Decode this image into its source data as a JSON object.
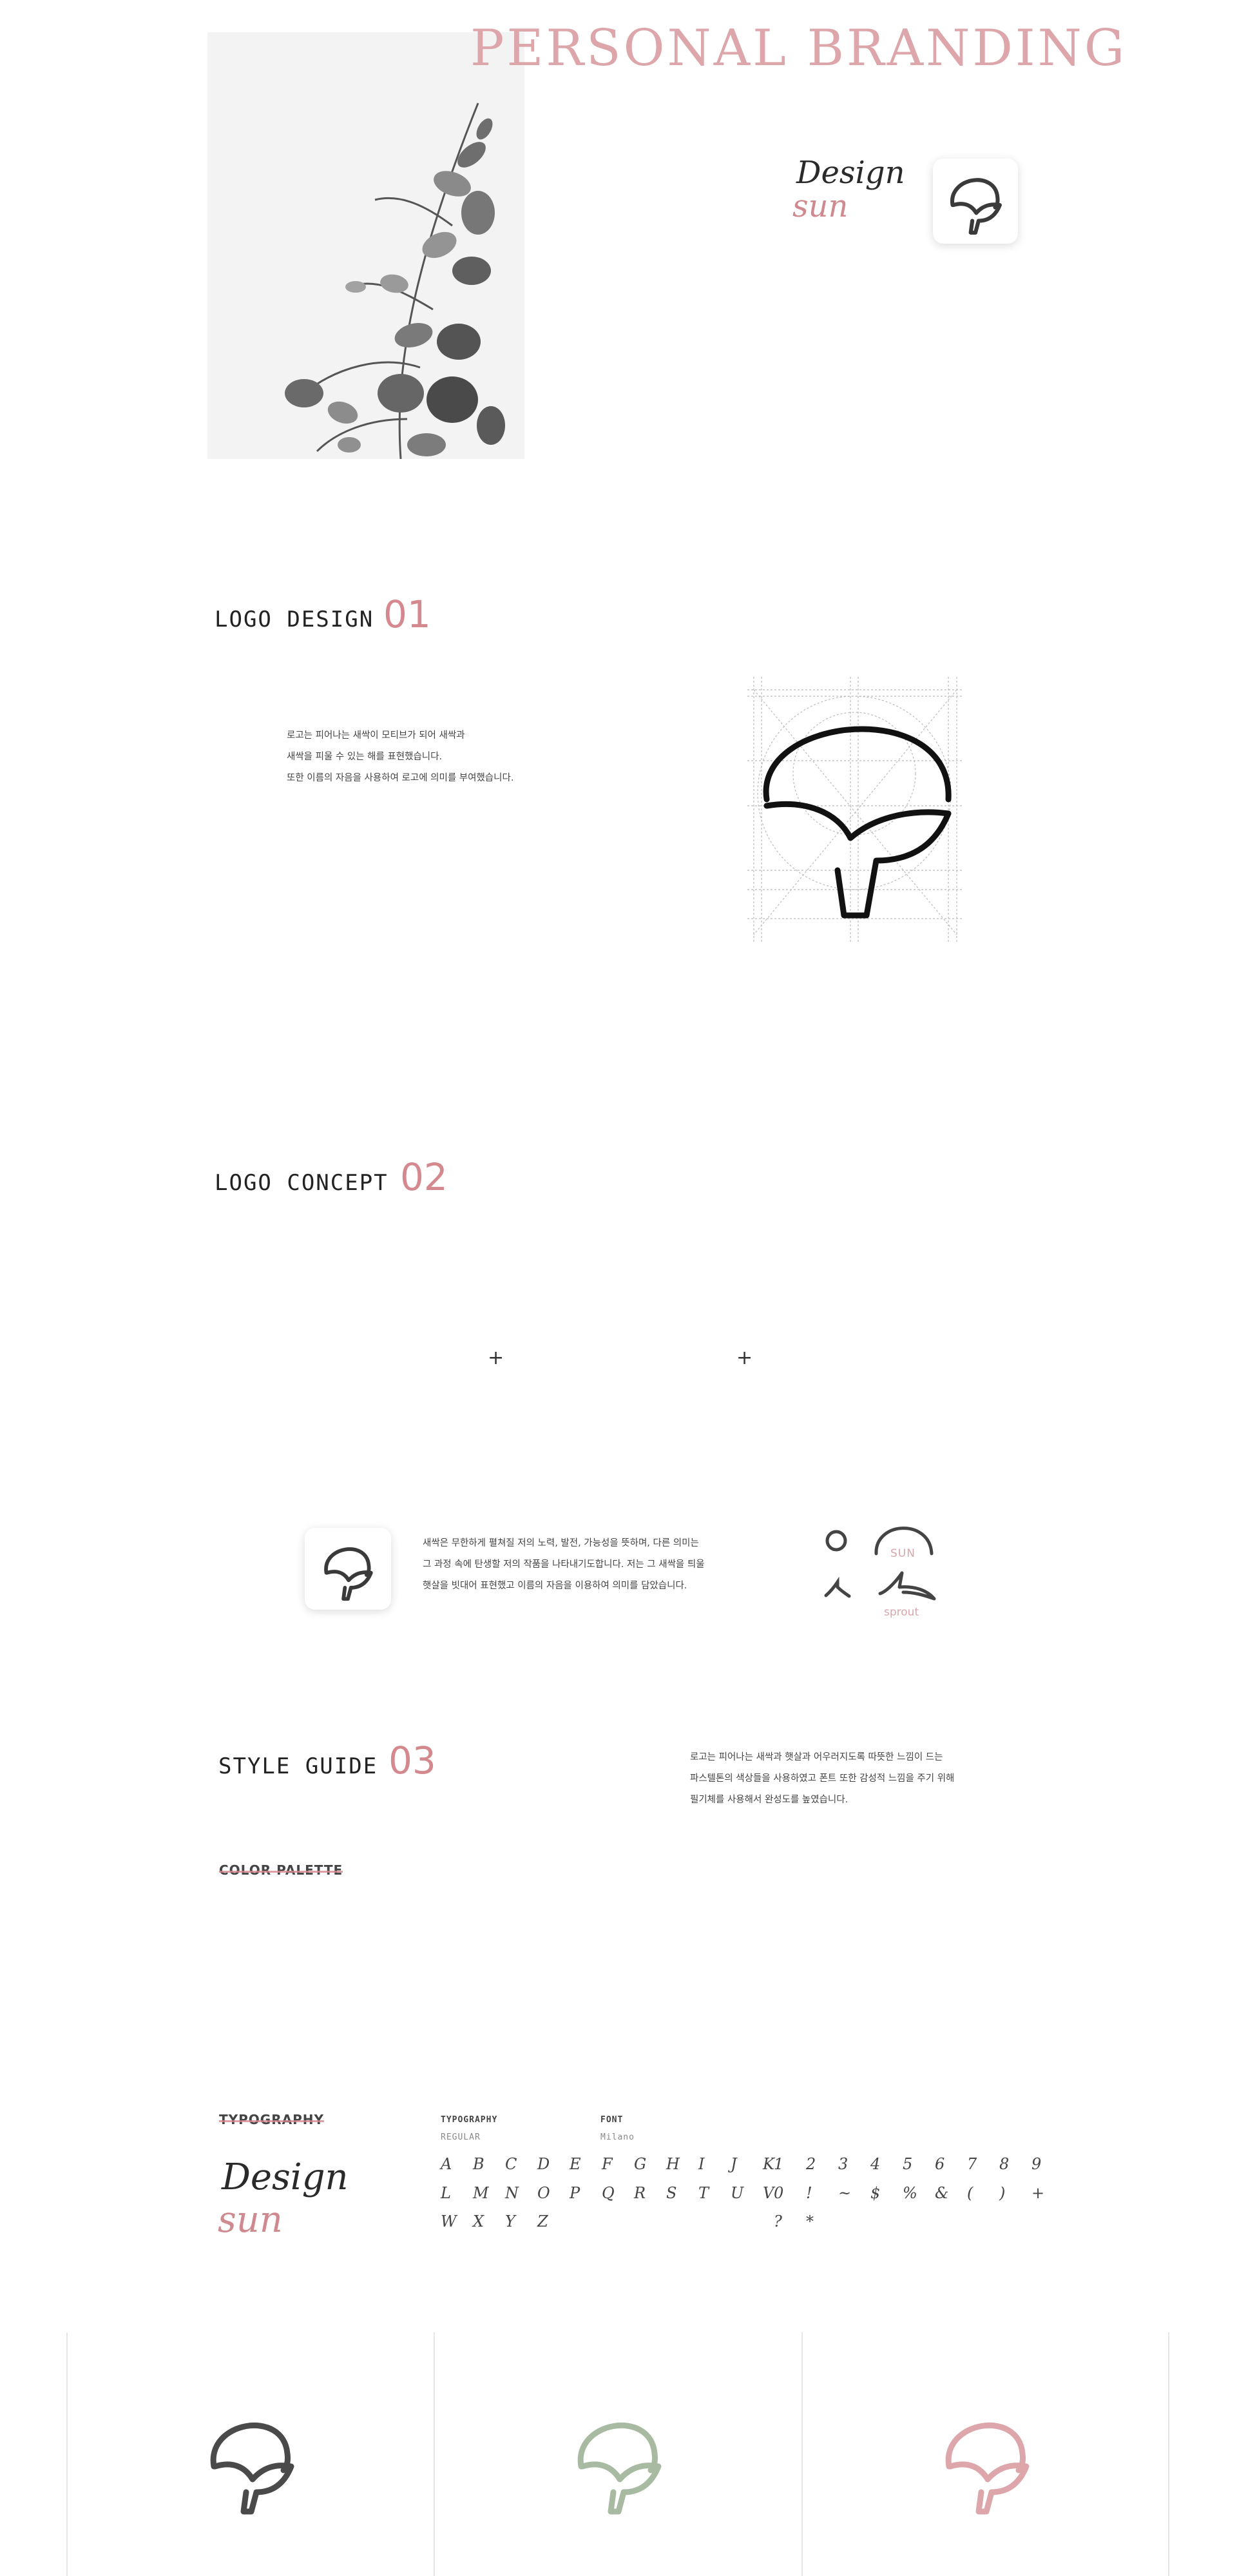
{
  "hero": {
    "title": "PERSONAL BRANDING",
    "script_line1": "Design",
    "script_line2": "sun",
    "photo_icon": "eucalyptus-branch-photo"
  },
  "logo_design": {
    "title": "LOGO DESIGN",
    "number": "01",
    "paragraph": [
      "로고는 피어나는 새싹이 모티브가 되어 새싹과",
      "새싹을 피울 수 있는 해를 표현했습니다.",
      "또한 이름의 자음을 사용하여 로고에 의미를 부여했습니다."
    ]
  },
  "logo_concept": {
    "title": "LOGO CONCEPT",
    "number": "02",
    "plus_1": "+",
    "plus_2": "+",
    "paragraph": [
      "새싹은 무한하게 펼쳐질 저의 노력, 발전, 가능성을 뜻하며, 다른 의미는",
      "그 과정 속에 탄생할 저의 작품을 나타내기도합니다. 저는 그 새싹을 틔울",
      "햇살을 빗대어 표현했고 이름의 자음을 이용하여 의미를 담았습니다."
    ],
    "sun_label": "SUN",
    "sprout_label": "sprout"
  },
  "style_guide": {
    "title": "STYLE GUIDE",
    "number": "03",
    "paragraph": [
      "로고는 피어나는 새싹과 햇살과 어우러지도록 따뜻한 느낌이 드는",
      "파스텔톤의 색상들을 사용하였고 폰트 또한 감성적 느낌을 주기 위해",
      "필기체를 사용해서 완성도를 높였습니다."
    ],
    "color_palette_heading": "COLOR PALETTE",
    "typography_heading": "TYPOGRAPHY",
    "typography_label": "TYPOGRAPHY",
    "typography_weight": "REGULAR",
    "font_label": "FONT",
    "font_name": "Milano",
    "script_line1": "Design",
    "script_line2": "sun",
    "glyph_rows": [
      [
        "A",
        "B",
        "C",
        "D",
        "E",
        "F",
        "G",
        "H",
        "I",
        "J",
        "K"
      ],
      [
        "L",
        "M",
        "N",
        "O",
        "P",
        "Q",
        "R",
        "S",
        "T",
        "U",
        "V"
      ],
      [
        "W",
        "X",
        "Y",
        "Z"
      ]
    ],
    "number_rows": [
      [
        "1",
        "2",
        "3",
        "4",
        "5",
        "6",
        "7",
        "8",
        "9"
      ],
      [
        "0",
        "!",
        "~",
        "$",
        "%",
        "&",
        "(",
        ")",
        "+"
      ],
      [
        "?",
        "*"
      ]
    ]
  },
  "variants": [
    {
      "name": "dark",
      "color": "#4a4a4a"
    },
    {
      "name": "sage",
      "color": "#a8bba2"
    },
    {
      "name": "pink",
      "color": "#dca6aa"
    }
  ],
  "colors": {
    "accent_pink": "#d4898f",
    "title_pink": "#dca6aa",
    "text_dark": "#222222"
  }
}
